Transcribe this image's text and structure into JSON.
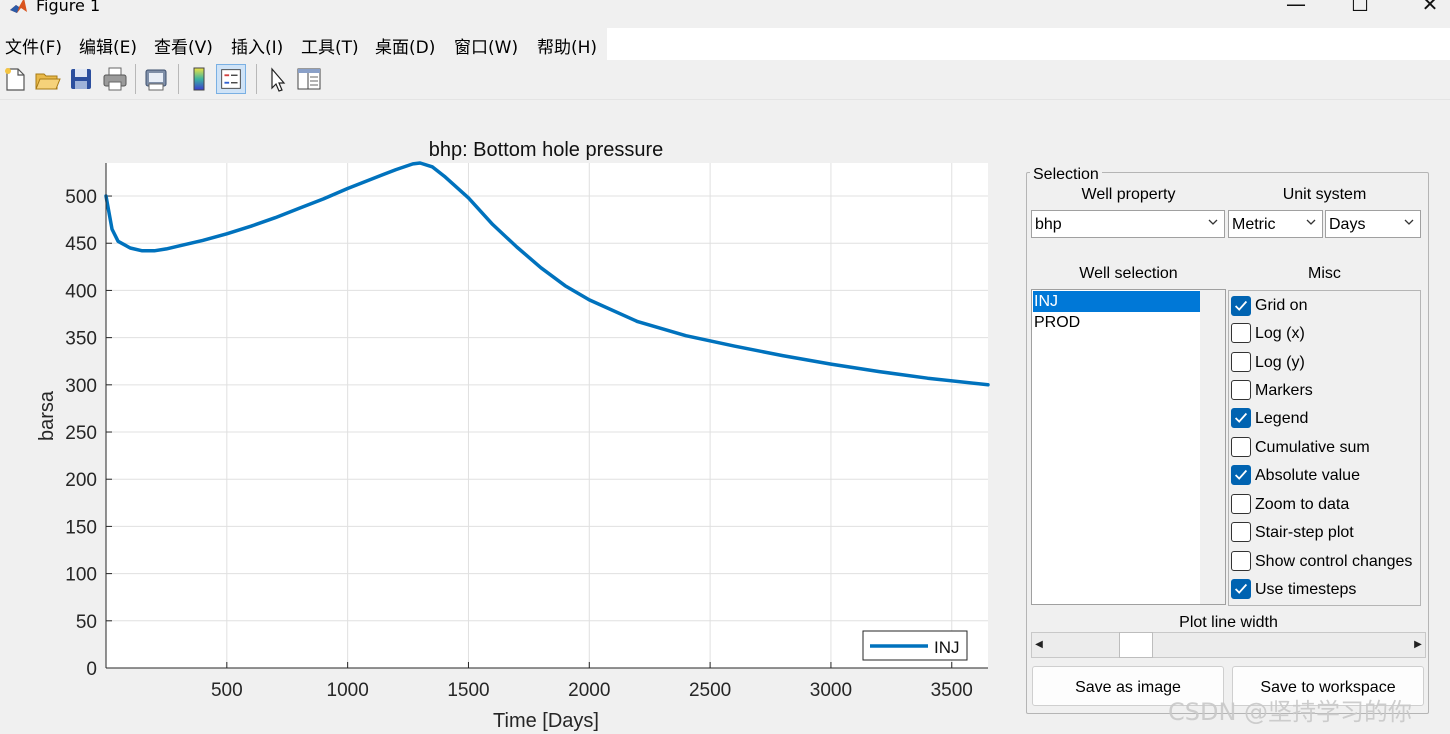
{
  "window": {
    "title": "Figure 1",
    "minimize": "—",
    "maximize": "☐",
    "close": "✕"
  },
  "menu": [
    "文件(F)",
    "编辑(E)",
    "查看(V)",
    "插入(I)",
    "工具(T)",
    "桌面(D)",
    "窗口(W)",
    "帮助(H)"
  ],
  "toolbar": {
    "icons": [
      "new-figure-icon",
      "open-file-icon",
      "save-icon",
      "print-icon",
      "print-preview-icon",
      "colorbar-icon",
      "legend-icon",
      "pointer-icon",
      "property-editor-icon"
    ],
    "active": "legend-icon"
  },
  "chart_data": {
    "type": "line",
    "title": "bhp: Bottom hole pressure",
    "xlabel": "Time [Days]",
    "ylabel": "barsa",
    "xlim": [
      0,
      3650
    ],
    "ylim": [
      0,
      535
    ],
    "xticks": [
      500,
      1000,
      1500,
      2000,
      2500,
      3000,
      3500
    ],
    "yticks": [
      0,
      50,
      100,
      150,
      200,
      250,
      300,
      350,
      400,
      450,
      500
    ],
    "grid": true,
    "legend_position": "bottom-right",
    "series": [
      {
        "name": "INJ",
        "color": "#0072bd",
        "x": [
          0,
          25,
          50,
          100,
          150,
          200,
          250,
          300,
          400,
          500,
          600,
          700,
          800,
          900,
          1000,
          1100,
          1200,
          1270,
          1300,
          1350,
          1400,
          1500,
          1600,
          1700,
          1800,
          1900,
          2000,
          2200,
          2400,
          2600,
          2800,
          3000,
          3200,
          3400,
          3650
        ],
        "y": [
          500,
          465,
          452,
          445,
          442,
          442,
          444,
          447,
          453,
          460,
          468,
          477,
          487,
          497,
          508,
          518,
          528,
          534,
          535,
          531,
          521,
          498,
          470,
          446,
          424,
          405,
          390,
          367,
          352,
          341,
          331,
          322,
          314,
          307,
          300
        ]
      }
    ]
  },
  "panel": {
    "title": "Selection",
    "well_property_label": "Well property",
    "unit_system_label": "Unit system",
    "property_value": "bhp",
    "unit_value": "Metric",
    "time_unit_value": "Days",
    "well_selection_label": "Well selection",
    "misc_label": "Misc",
    "wells": [
      "INJ",
      "PROD"
    ],
    "selected_well": "INJ",
    "misc": [
      {
        "label": "Grid on",
        "checked": true
      },
      {
        "label": "Log (x)",
        "checked": false
      },
      {
        "label": "Log (y)",
        "checked": false
      },
      {
        "label": "Markers",
        "checked": false
      },
      {
        "label": "Legend",
        "checked": true
      },
      {
        "label": "Cumulative sum",
        "checked": false
      },
      {
        "label": "Absolute value",
        "checked": true
      },
      {
        "label": "Zoom to data",
        "checked": false
      },
      {
        "label": "Stair-step plot",
        "checked": false
      },
      {
        "label": "Show control changes",
        "checked": false
      },
      {
        "label": "Use timesteps",
        "checked": true
      }
    ],
    "line_width_label": "Plot line width",
    "line_width_value": 0.22,
    "save_image": "Save as image",
    "save_workspace": "Save to workspace"
  },
  "watermark": "CSDN @坚持学习的你"
}
